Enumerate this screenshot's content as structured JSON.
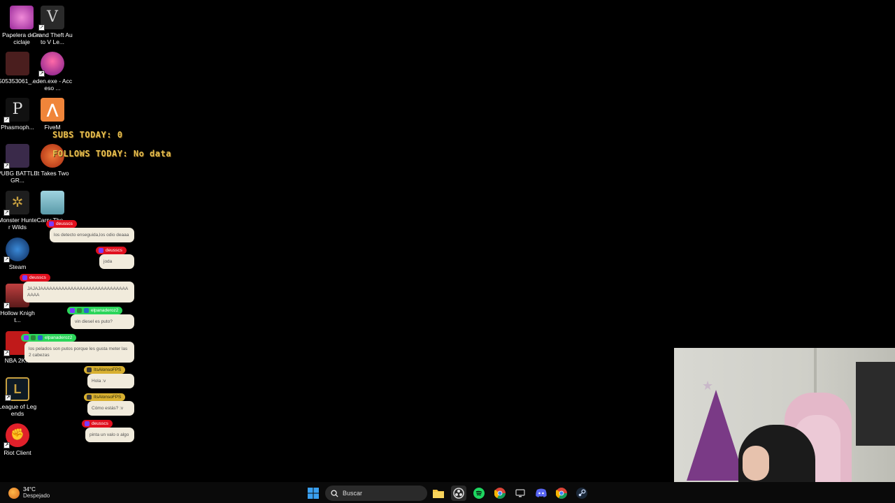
{
  "desktop": {
    "icons": [
      {
        "label": "Papelera de reciclaje",
        "name": "recycle-bin-icon",
        "color": "#c04fb0"
      },
      {
        "label": "Grand Theft Auto V Le...",
        "name": "gta-v-icon",
        "color": "#7a7a7a"
      },
      {
        "label": "505353061_...",
        "name": "image-file-icon",
        "color": "#5a2a2a"
      },
      {
        "label": "eden.exe - Acceso ...",
        "name": "eden-exe-icon",
        "color": "#d4508a"
      },
      {
        "label": "Phasmoph...",
        "name": "phasmophobia-icon",
        "color": "#1a1a1a"
      },
      {
        "label": "FiveM",
        "name": "fivem-icon",
        "color": "#f08a3c"
      },
      {
        "label": "PUBG BATTLEGR...",
        "name": "pubg-icon",
        "color": "#3a2a4a"
      },
      {
        "label": "It Takes Two",
        "name": "it-takes-two-icon",
        "color": "#d05020"
      },
      {
        "label": "Monster Hunter Wilds",
        "name": "monster-hunter-icon",
        "color": "#2a2a2a"
      },
      {
        "label": "Carry The...",
        "name": "carry-the-icon",
        "color": "#6aa8b8"
      },
      {
        "label": "Steam",
        "name": "steam-icon",
        "color": "#1b3a6a"
      },
      {
        "label": "Hollow Knight...",
        "name": "hollow-knight-icon",
        "color": "#8a2a2a"
      },
      {
        "label": "NBA 2K...",
        "name": "nba-2k-icon",
        "color": "#c01a1a"
      },
      {
        "label": "League of Legends",
        "name": "league-of-legends-icon",
        "color": "#c8a040"
      },
      {
        "label": "Riot Client",
        "name": "riot-client-icon",
        "color": "#e0202a"
      }
    ]
  },
  "overlay": {
    "subs_today": "SUBS TODAY: 0",
    "follows_today": "FOLLOWS TODAY: No data"
  },
  "chat": {
    "messages": [
      {
        "user": "deusscs",
        "text": "los detecto enseguida,los odio deaaa",
        "badge_color": "#e0101e"
      },
      {
        "user": "deusscs",
        "text": "joda",
        "badge_color": "#e0101e"
      },
      {
        "user": "deusscs",
        "text": "JAJAJAAAAAAAAAAAAAAAAAAAAAAAAAAAAAAAAA",
        "badge_color": "#e0101e"
      },
      {
        "user": "elpanaderoz2",
        "text": "vin diesel es puto?",
        "badge_color": "#2bd65a"
      },
      {
        "user": "elpanaderoz2",
        "text": "los pelados son putos porque les gusta meter las 2 cabezas",
        "badge_color": "#2bd65a"
      },
      {
        "user": "ItsAlonsoFPS",
        "text": "Hola :v",
        "badge_color": "#d8b030"
      },
      {
        "user": "ItsAlonsoFPS",
        "text": "Cómo estás? :v",
        "badge_color": "#d8b030"
      },
      {
        "user": "deusscs",
        "text": "pinta un valo o algo",
        "badge_color": "#e0101e"
      }
    ]
  },
  "taskbar": {
    "weather_temp": "34°C",
    "weather_desc": "Despejado",
    "search_placeholder": "Buscar"
  }
}
